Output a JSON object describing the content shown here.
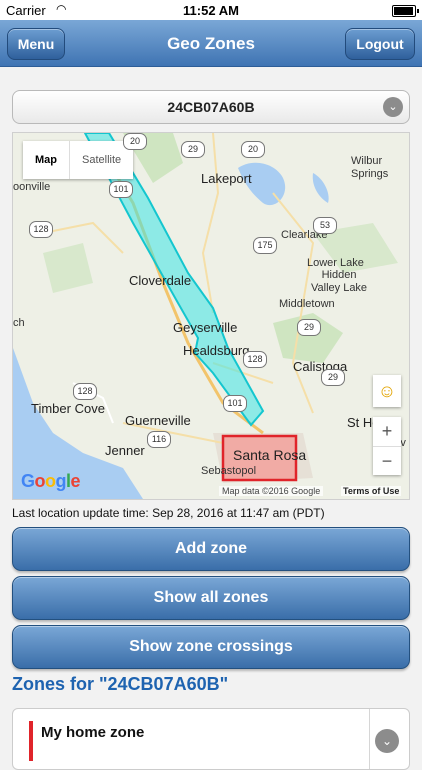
{
  "status_bar": {
    "carrier": "Carrier",
    "time": "11:52 AM",
    "battery_level": 0.95
  },
  "nav": {
    "title": "Geo Zones",
    "menu_label": "Menu",
    "logout_label": "Logout"
  },
  "device_select": {
    "value": "24CB07A60B"
  },
  "map": {
    "type_map": "Map",
    "type_satellite": "Satellite",
    "places": {
      "boonville": "oonville",
      "lakeport": "Lakeport",
      "wilbur_springs": "Wilbur\nSprings",
      "clearlake": "Clearlake",
      "lower_lake": "Lower Lake",
      "hidden_valley_lake": "Hidden\nValley Lake",
      "cloverdale": "Cloverdale",
      "middletown": "Middletown",
      "ch": "ch",
      "geyserville": "Geyserville",
      "healdsburg": "Healdsburg",
      "calistoga": "Calistoga",
      "timber_cove": "Timber Cove",
      "guerneville": "Guerneville",
      "st_helena": "St Hele",
      "jenner": "Jenner",
      "santa_rosa": "Santa Rosa",
      "sebastopol": "Sebastopol",
      "yountville": "ountv"
    },
    "shields": [
      "20",
      "29",
      "20",
      "101",
      "128",
      "53",
      "175",
      "29",
      "128",
      "29",
      "128",
      "101",
      "116"
    ],
    "google": "Google",
    "attribution": "Map data ©2016 Google",
    "terms": "Terms of Use",
    "zoom_in": "+",
    "zoom_out": "−"
  },
  "last_update": "Last location update time: Sep 28, 2016 at 11:47 am (PDT)",
  "buttons": {
    "add_zone": "Add zone",
    "show_all": "Show all zones",
    "show_crossings": "Show zone crossings"
  },
  "zones_heading": "Zones for \"24CB07A60B\"",
  "zones": [
    {
      "name": "My home zone",
      "color": "#e0242a"
    }
  ],
  "colors": {
    "accent": "#3f74b3",
    "zone_corridor": "#3ee6e6",
    "zone_home": "#e0242a",
    "heading": "#1e63b0"
  }
}
